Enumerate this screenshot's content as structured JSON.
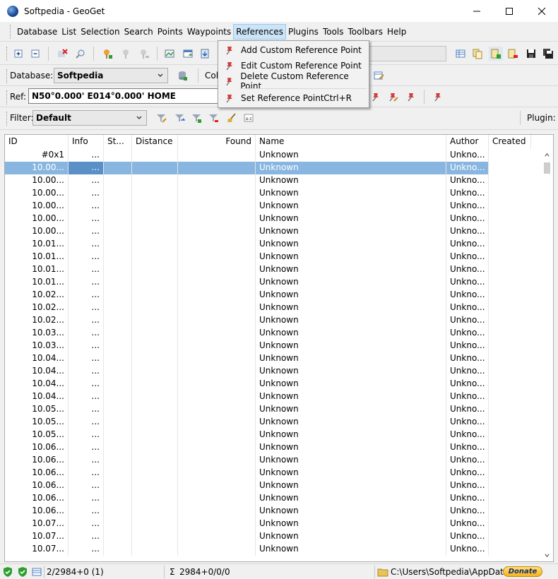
{
  "window": {
    "title": "Softpedia - GeoGet"
  },
  "menu": [
    "Database",
    "List",
    "Selection",
    "Search",
    "Points",
    "Waypoints",
    "References",
    "Plugins",
    "Tools",
    "Toolbars",
    "Help"
  ],
  "active_menu": "References",
  "toolbar2": {
    "database_label": "Database:",
    "database_value": "Softpedia",
    "col_label": "Col"
  },
  "toolbar3": {
    "ref_label": "Ref:",
    "ref_value": "N50°0.000' E014°0.000' HOME"
  },
  "toolbar4": {
    "filter_label": "Filter:",
    "filter_value": "Default",
    "plugin_label": "Plugin:"
  },
  "dropdown": {
    "items": [
      {
        "label": "Add Custom Reference Point",
        "shortcut": ""
      },
      {
        "label": "Edit Custom Reference Point",
        "shortcut": ""
      },
      {
        "label": "Delete Custom Reference Point",
        "shortcut": ""
      },
      {
        "label": "Set Reference Point",
        "shortcut": "Ctrl+R"
      }
    ]
  },
  "grid": {
    "columns": [
      "ID",
      "Info",
      "St...",
      "Distance",
      "Found",
      "Name",
      "Author",
      "Created"
    ],
    "rows": [
      [
        "#0x1",
        "...",
        "",
        "",
        "",
        "Unknown",
        "Unkno..."
      ],
      [
        "10.00...",
        "...",
        "",
        "",
        "",
        "Unknown",
        "Unkno..."
      ],
      [
        "10.00...",
        "...",
        "",
        "",
        "",
        "Unknown",
        "Unkno..."
      ],
      [
        "10.00...",
        "...",
        "",
        "",
        "",
        "Unknown",
        "Unkno..."
      ],
      [
        "10.00...",
        "...",
        "",
        "",
        "",
        "Unknown",
        "Unkno..."
      ],
      [
        "10.00...",
        "...",
        "",
        "",
        "",
        "Unknown",
        "Unkno..."
      ],
      [
        "10.00...",
        "...",
        "",
        "",
        "",
        "Unknown",
        "Unkno..."
      ],
      [
        "10.01...",
        "...",
        "",
        "",
        "",
        "Unknown",
        "Unkno..."
      ],
      [
        "10.01...",
        "...",
        "",
        "",
        "",
        "Unknown",
        "Unkno..."
      ],
      [
        "10.01...",
        "...",
        "",
        "",
        "",
        "Unknown",
        "Unkno..."
      ],
      [
        "10.01...",
        "...",
        "",
        "",
        "",
        "Unknown",
        "Unkno..."
      ],
      [
        "10.02...",
        "...",
        "",
        "",
        "",
        "Unknown",
        "Unkno..."
      ],
      [
        "10.02...",
        "...",
        "",
        "",
        "",
        "Unknown",
        "Unkno..."
      ],
      [
        "10.02...",
        "...",
        "",
        "",
        "",
        "Unknown",
        "Unkno..."
      ],
      [
        "10.03...",
        "...",
        "",
        "",
        "",
        "Unknown",
        "Unkno..."
      ],
      [
        "10.03...",
        "...",
        "",
        "",
        "",
        "Unknown",
        "Unkno..."
      ],
      [
        "10.04...",
        "...",
        "",
        "",
        "",
        "Unknown",
        "Unkno..."
      ],
      [
        "10.04...",
        "...",
        "",
        "",
        "",
        "Unknown",
        "Unkno..."
      ],
      [
        "10.04...",
        "...",
        "",
        "",
        "",
        "Unknown",
        "Unkno..."
      ],
      [
        "10.04...",
        "...",
        "",
        "",
        "",
        "Unknown",
        "Unkno..."
      ],
      [
        "10.05...",
        "...",
        "",
        "",
        "",
        "Unknown",
        "Unkno..."
      ],
      [
        "10.05...",
        "...",
        "",
        "",
        "",
        "Unknown",
        "Unkno..."
      ],
      [
        "10.05...",
        "...",
        "",
        "",
        "",
        "Unknown",
        "Unkno..."
      ],
      [
        "10.06...",
        "...",
        "",
        "",
        "",
        "Unknown",
        "Unkno..."
      ],
      [
        "10.06...",
        "...",
        "",
        "",
        "",
        "Unknown",
        "Unkno..."
      ],
      [
        "10.06...",
        "...",
        "",
        "",
        "",
        "Unknown",
        "Unkno..."
      ],
      [
        "10.06...",
        "...",
        "",
        "",
        "",
        "Unknown",
        "Unkno..."
      ],
      [
        "10.06...",
        "...",
        "",
        "",
        "",
        "Unknown",
        "Unkno..."
      ],
      [
        "10.06...",
        "...",
        "",
        "",
        "",
        "Unknown",
        "Unkno..."
      ],
      [
        "10.07...",
        "...",
        "",
        "",
        "",
        "Unknown",
        "Unkno..."
      ],
      [
        "10.07...",
        "...",
        "",
        "",
        "",
        "Unknown",
        "Unkno..."
      ],
      [
        "10.07...",
        "...",
        "",
        "",
        "",
        "Unknown",
        "Unkno..."
      ]
    ],
    "selected_row": 1
  },
  "statusbar": {
    "selection": "2/2984+0 (1)",
    "sigma": "Σ",
    "sum": "2984+0/0/0",
    "path": "C:\\Users\\Softpedia\\AppData\\",
    "donate": "Donate"
  },
  "colors": {
    "selection": "#88b6e0",
    "menu_active": "#cce4f7"
  }
}
